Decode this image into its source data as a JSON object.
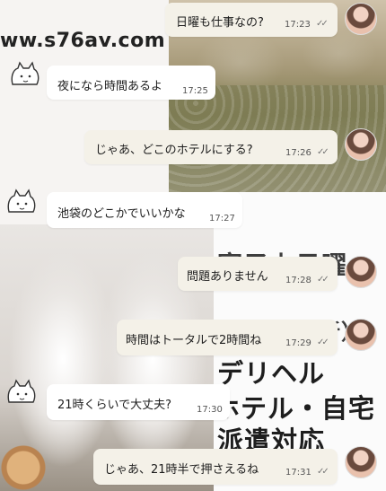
{
  "watermark": "ww.s76av.com",
  "background_text": [
    "寝子上日曜",
    "（新）",
    "デリヘル",
    "ホテル・自宅",
    "派遣対応"
  ],
  "messages": [
    {
      "side": "out",
      "text": "日曜も仕事なの?",
      "time": "17:23",
      "status": "read"
    },
    {
      "side": "in",
      "text": "夜になら時間あるよ",
      "time": "17:25"
    },
    {
      "side": "out",
      "text": "じゃあ、どこのホテルにする?",
      "time": "17:26",
      "status": "read"
    },
    {
      "side": "in",
      "text": "池袋のどこかでいいかな",
      "time": "17:27"
    },
    {
      "side": "out",
      "text": "問題ありません",
      "time": "17:28",
      "status": "read"
    },
    {
      "side": "out",
      "text": "時間はトータルで2時間ね",
      "time": "17:29",
      "status": "read"
    },
    {
      "side": "in",
      "text": "21時くらいで大丈夫?",
      "time": "17:30"
    },
    {
      "side": "out",
      "text": "じゃあ、21時半で押さえるね",
      "time": "17:31",
      "status": "read"
    }
  ],
  "icons": {
    "read_receipt": "double-check-icon",
    "contact_avatar": "contact-avatar",
    "my_avatar": "user-avatar"
  }
}
